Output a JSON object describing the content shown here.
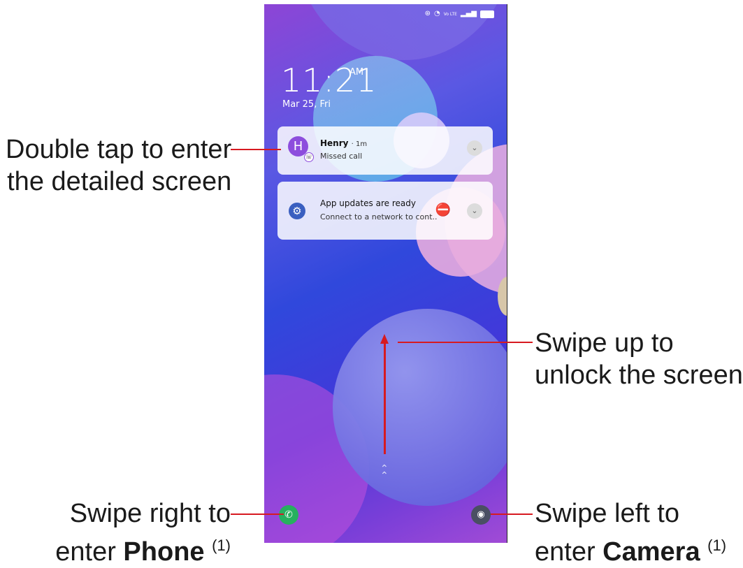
{
  "phone": {
    "status_icons": [
      "nfc-icon",
      "wifi-icon",
      "volte-icon",
      "signal-icon",
      "battery-icon"
    ],
    "status_volte_text": "Vo LTE",
    "clock_time": "11:21",
    "clock_ampm": "AM",
    "date": "Mar 25, Fri",
    "notifications": [
      {
        "avatar_letter": "H",
        "title": "Henry",
        "meta": "· 1m",
        "body": "Missed call"
      },
      {
        "title": "App updates are ready",
        "body": "Connect to a network to cont.."
      }
    ]
  },
  "annotations": {
    "double_tap_line1": "Double tap to enter",
    "double_tap_line2": "the detailed screen",
    "swipe_up_line1": "Swipe up to",
    "swipe_up_line2": "unlock the screen",
    "swipe_right_line1": "Swipe right to",
    "swipe_right_line2_prefix": "enter ",
    "swipe_right_bold": "Phone",
    "swipe_right_sup": "(1)",
    "swipe_left_line1": "Swipe left to",
    "swipe_left_line2_prefix": "enter ",
    "swipe_left_bold": "Camera",
    "swipe_left_sup": "(1)"
  },
  "colors": {
    "annotation_line": "#d71a20",
    "phone_button": "#27b05f",
    "camera_button": "#4a4f63"
  }
}
